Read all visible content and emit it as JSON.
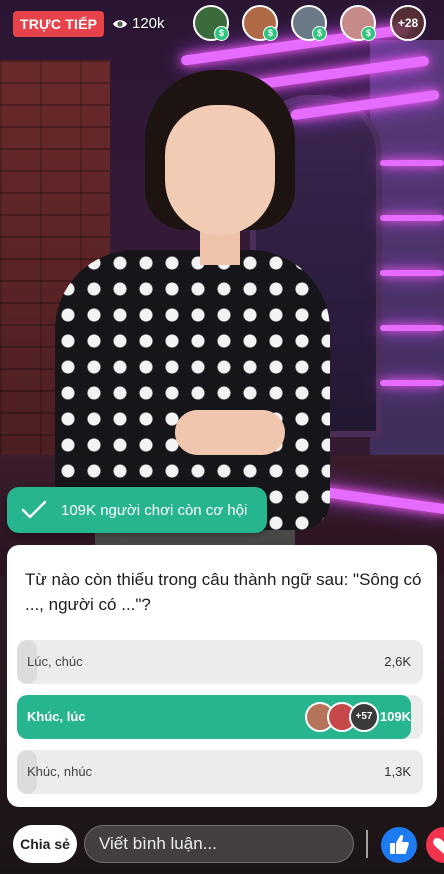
{
  "top_bar": {
    "live_label": "TRỰC TIẾP",
    "viewer_count": "120k",
    "viewer_avatars": [
      {
        "badge": "$",
        "color": "#3b6b3b"
      },
      {
        "badge": "$",
        "color": "#b06a48"
      },
      {
        "badge": "$",
        "color": "#6a7a86"
      },
      {
        "badge": "$",
        "color": "#c78a8a"
      }
    ],
    "more_viewers": "+28"
  },
  "status": {
    "players_remaining": "109K người chơi còn cơ hội"
  },
  "question": {
    "text": "Từ nào còn thiếu trong câu thành ngữ sau: \"Sông có ..., người có ...\"?",
    "options": [
      {
        "label": "Lúc, chúc",
        "count": "2,6K",
        "fill": 0.05,
        "correct": false
      },
      {
        "label": "Khúc, lúc",
        "count": "109K",
        "fill": 0.97,
        "correct": true,
        "voters_more": "+57"
      },
      {
        "label": "Khúc, nhúc",
        "count": "1,3K",
        "fill": 0.05,
        "correct": false
      }
    ]
  },
  "bottom_bar": {
    "share_label": "Chia sẻ",
    "comment_placeholder": "Viết bình luận...",
    "like_icon": "thumbs-up-icon",
    "love_icon": "heart-icon"
  },
  "colors": {
    "live": "#e8424a",
    "accent": "#27b590",
    "like": "#1d7cf2",
    "love": "#f0334f"
  }
}
